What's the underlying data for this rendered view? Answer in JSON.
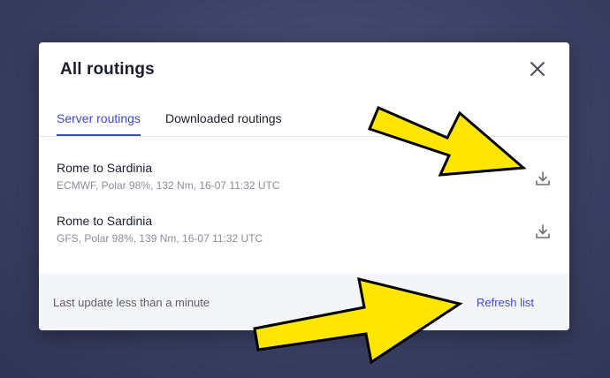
{
  "dialog": {
    "title": "All routings",
    "close_icon": "close-icon"
  },
  "tabs": [
    {
      "label": "Server routings",
      "active": true
    },
    {
      "label": "Downloaded routings",
      "active": false
    }
  ],
  "routes": [
    {
      "name": "Rome to Sardinia",
      "meta": "ECMWF, Polar 98%, 132 Nm, 16-07 11:32 UTC",
      "icon": "download-icon"
    },
    {
      "name": "Rome to Sardinia",
      "meta": "GFS, Polar 98%, 139 Nm, 16-07 11:32 UTC",
      "icon": "download-icon"
    }
  ],
  "footer": {
    "status": "Last update less than a minute",
    "refresh_label": "Refresh list"
  },
  "colors": {
    "accent": "#3a4bc8",
    "arrow_fill": "#ffe600",
    "arrow_stroke": "#000000",
    "backdrop": "#3a4063"
  },
  "annotations": [
    {
      "icon": "arrow-icon",
      "points_to": "download-button"
    },
    {
      "icon": "arrow-icon",
      "points_to": "refresh-list-link"
    }
  ]
}
